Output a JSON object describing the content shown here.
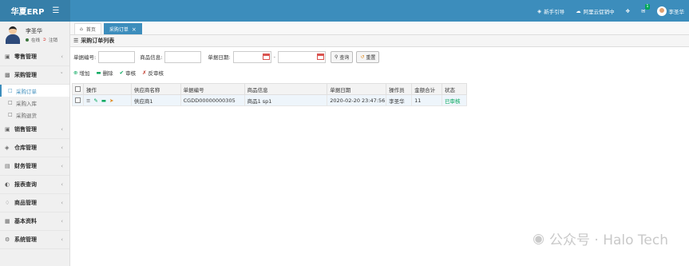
{
  "app": {
    "brand": "华夏ERP"
  },
  "topbar": {
    "guide_label": "新手引导",
    "cloud_label": "阿里云促销中",
    "notif_count": "1",
    "user_short": "李圣华"
  },
  "user": {
    "name": "李圣华",
    "status": "在线",
    "logout": "注销"
  },
  "sidebar": {
    "items": [
      {
        "label": "零售管理",
        "icon": "cart-icon"
      },
      {
        "label": "采购管理",
        "icon": "box-icon"
      },
      {
        "label": "销售管理",
        "icon": "sales-icon"
      },
      {
        "label": "仓库管理",
        "icon": "warehouse-icon"
      },
      {
        "label": "财务管理",
        "icon": "finance-icon"
      },
      {
        "label": "报表查询",
        "icon": "report-icon"
      },
      {
        "label": "商品管理",
        "icon": "goods-icon"
      },
      {
        "label": "基本资料",
        "icon": "data-icon"
      },
      {
        "label": "系统管理",
        "icon": "settings-icon"
      }
    ],
    "sub": [
      "采购订单",
      "采购入库",
      "采购退货"
    ]
  },
  "tabs": [
    {
      "label": "首页"
    },
    {
      "label": "采购订单"
    }
  ],
  "panel": {
    "title": "采购订单列表"
  },
  "search": {
    "bill_no_label": "单据编号:",
    "goods_label": "商品信息:",
    "date_label": "单据日期:",
    "date_sep": "-",
    "query": "查询",
    "reset": "重置"
  },
  "toolbar": {
    "add": "增加",
    "delete": "删除",
    "audit": "审核",
    "unaudit": "反审核"
  },
  "table": {
    "headers": [
      "操作",
      "供应商名称",
      "单据编号",
      "商品信息",
      "单据日期",
      "操作员",
      "金额合计",
      "状态"
    ],
    "rows": [
      {
        "supplier": "供应商1",
        "bill_no": "CGDD00000000305",
        "goods": "商品1 sp1",
        "date": "2020-02-20 23:47:56",
        "operator": "李圣华",
        "amount": "11",
        "status": "已审核"
      }
    ]
  },
  "watermark": "公众号 · Halo Tech",
  "colors": {
    "primary": "#3c8dbc",
    "success": "#00a65a"
  }
}
